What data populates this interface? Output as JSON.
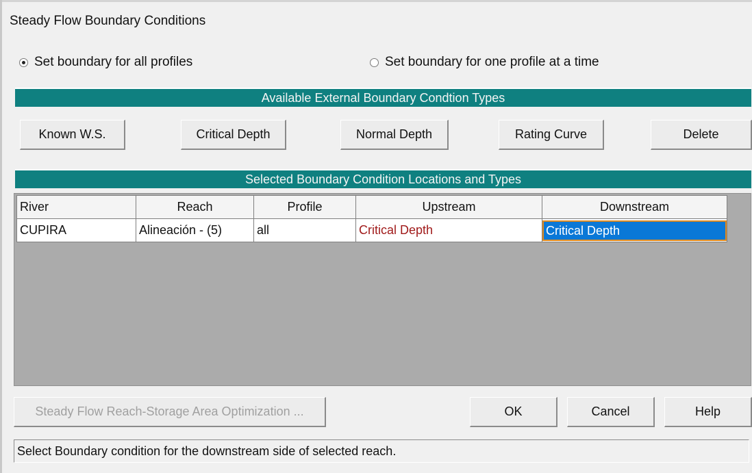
{
  "window": {
    "title": "Steady Flow Boundary Conditions"
  },
  "options": {
    "all_profiles": {
      "label": "Set boundary for all profiles",
      "checked": true
    },
    "one_profile": {
      "label": "Set boundary for one profile at a time",
      "checked": false
    }
  },
  "types_header": "Available External Boundary Condtion Types",
  "type_buttons": {
    "known_ws": "Known W.S.",
    "critical_depth": "Critical Depth",
    "normal_depth": "Normal Depth",
    "rating_curve": "Rating Curve",
    "delete": "Delete"
  },
  "locations_header": "Selected Boundary Condition Locations and Types",
  "table": {
    "columns": [
      "River",
      "Reach",
      "Profile",
      "Upstream",
      "Downstream"
    ],
    "rows": [
      [
        "CUPIRA",
        "Alineación - (5)",
        "all",
        "Critical Depth",
        "Critical Depth"
      ]
    ]
  },
  "bottom_buttons": {
    "optimization": "Steady Flow Reach-Storage Area Optimization ...",
    "ok": "OK",
    "cancel": "Cancel",
    "help": "Help"
  },
  "status_text": "Select Boundary condition for the downstream side of selected reach."
}
